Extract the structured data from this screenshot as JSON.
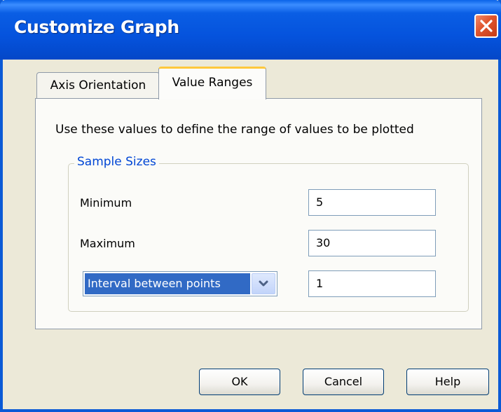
{
  "window": {
    "title": "Customize Graph",
    "colors": {
      "titlebar": "#0553dd",
      "face": "#ece9d8",
      "close_button": "#e0542c",
      "active_tab_accent": "#ffc83c",
      "group_legend": "#0046d5",
      "selection": "#316ac5"
    }
  },
  "tabs": [
    {
      "label": "Axis Orientation",
      "selected": false
    },
    {
      "label": "Value Ranges",
      "selected": true
    }
  ],
  "panel": {
    "description": "Use these values to define the range of values to be plotted",
    "group": {
      "legend": "Sample Sizes",
      "minimum": {
        "label": "Minimum",
        "value": "5"
      },
      "maximum": {
        "label": "Maximum",
        "value": "30"
      },
      "interval": {
        "selected_option": "Interval between points",
        "value": "1"
      }
    }
  },
  "buttons": {
    "ok": "OK",
    "cancel": "Cancel",
    "help": "Help"
  },
  "icons": {
    "close": "close-icon",
    "dropdown": "chevron-down-icon"
  }
}
